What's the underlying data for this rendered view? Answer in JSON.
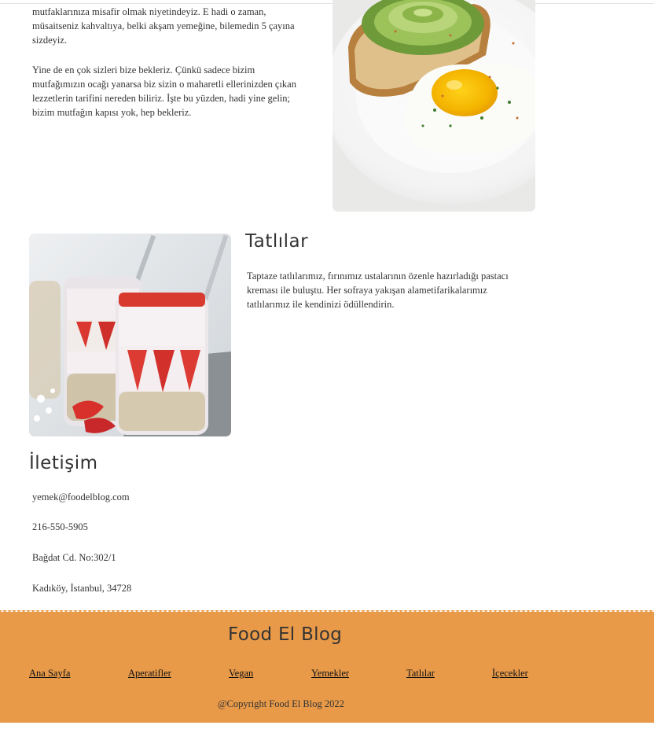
{
  "about": {
    "paragraph1": "mutfaklarınıza misafir olmak niyetindeyiz. E hadi o zaman, müsaitseniz kahvaltıya, belki akşam yemeğine, bilemedin 5 çayına sizdeyiz.",
    "paragraph2": "Yine de en çok sizleri bize bekleriz. Çünkü sadece bizim mutfağımızın ocağı yanarsa biz sizin o maharetli ellerinizden çıkan lezzetlerin tarifini nereden biliriz. İşte bu yüzden, hadi yine gelin; bizim mutfağın kapısı yok, hep bekleriz."
  },
  "desserts": {
    "title": "Tatlılar",
    "text": "Taptaze tatlılarımız, fırınımız ustalarının özenle hazırladığı pastacı kreması ile buluştu. Her sofraya yakışan alametifarikalarımız tatlılarımız ile kendinizi ödüllendirin."
  },
  "contact": {
    "title": "İletişim",
    "email": "yemek@foodelblog.com",
    "phone": "216-550-5905",
    "address_line1": "Bağdat Cd. No:302/1",
    "address_line2": "Kadıköy, İstanbul, 34728"
  },
  "footer": {
    "brand": "Food El Blog",
    "nav": [
      "Ana Sayfa",
      "Aperatifler",
      "Vegan",
      "Yemekler",
      "Tatlılar",
      "İçecekler"
    ],
    "copyright": "@Copyright Food El Blog 2022",
    "background_color": "#e89a49"
  },
  "images": {
    "photo1": "avocado-toast-fried-egg-photo",
    "photo2": "strawberry-yogurt-parfait-photo"
  }
}
